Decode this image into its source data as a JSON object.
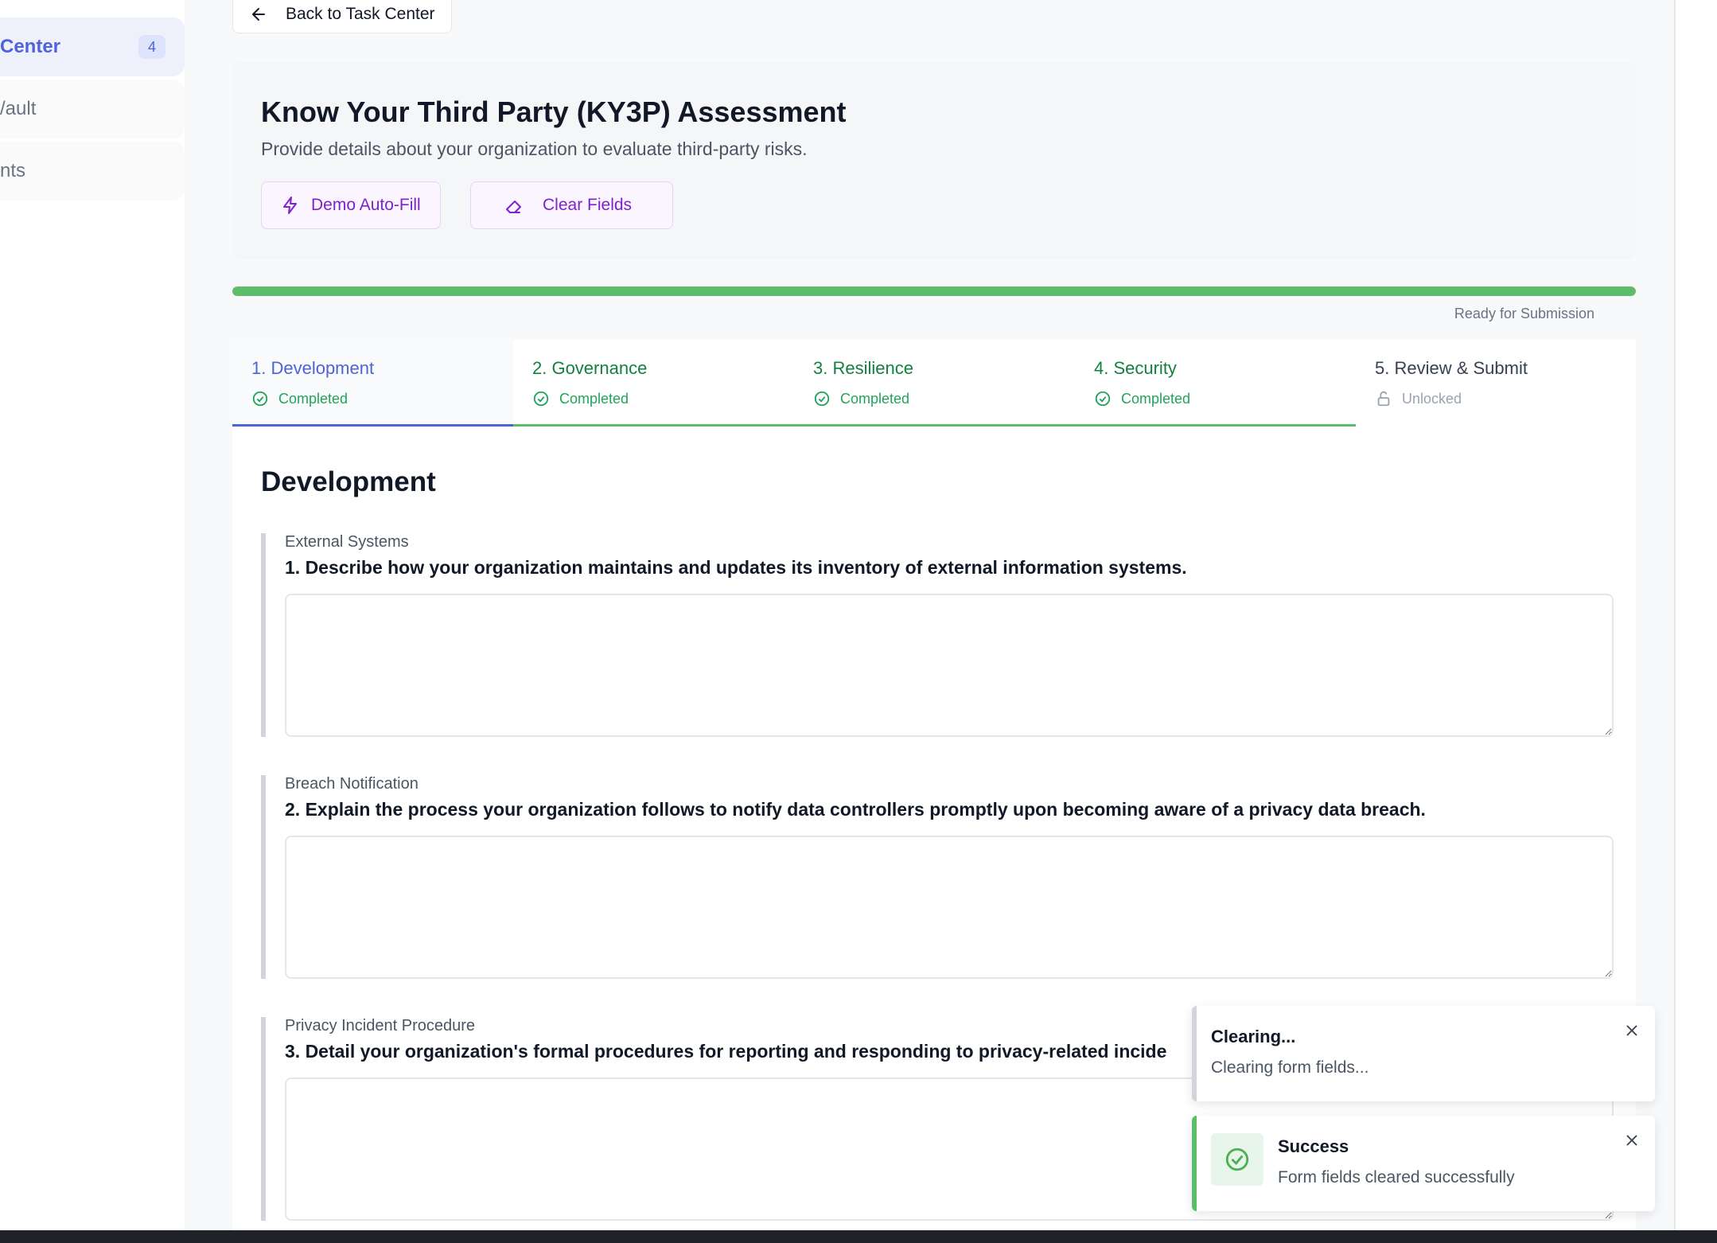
{
  "sidebar": {
    "items": [
      {
        "label": "Center",
        "badge": "4",
        "active": true
      },
      {
        "label": "/ault"
      },
      {
        "label": "nts"
      }
    ]
  },
  "back_button": {
    "label": "Back to Task Center"
  },
  "header": {
    "title": "Know Your Third Party (KY3P) Assessment",
    "subtitle": "Provide details about your organization to evaluate third-party risks.",
    "demo_autofill_label": "Demo Auto-Fill",
    "clear_fields_label": "Clear Fields"
  },
  "progress": {
    "value": 1.0,
    "status": "Ready for Submission"
  },
  "tabs": [
    {
      "label": "1. Development",
      "status": "Completed"
    },
    {
      "label": "2. Governance",
      "status": "Completed"
    },
    {
      "label": "3. Resilience",
      "status": "Completed"
    },
    {
      "label": "4. Security",
      "status": "Completed"
    },
    {
      "label": "5. Review & Submit",
      "status": "Unlocked"
    }
  ],
  "section": {
    "title": "Development",
    "questions": [
      {
        "category": "External Systems",
        "text": "1. Describe how your organization maintains and updates its inventory of external information systems.",
        "value": ""
      },
      {
        "category": "Breach Notification",
        "text": "2. Explain the process your organization follows to notify data controllers promptly upon becoming aware of a privacy data breach.",
        "value": ""
      },
      {
        "category": "Privacy Incident Procedure",
        "text": "3. Detail your organization's formal procedures for reporting and responding to privacy-related incide",
        "value": ""
      }
    ]
  },
  "toasts": [
    {
      "title": "Clearing...",
      "message": "Clearing form fields..."
    },
    {
      "title": "Success",
      "message": "Form fields cleared successfully"
    }
  ],
  "colors": {
    "accent": "#4f63d8",
    "success": "#5ebd6a",
    "purple": "#7e22ce"
  }
}
